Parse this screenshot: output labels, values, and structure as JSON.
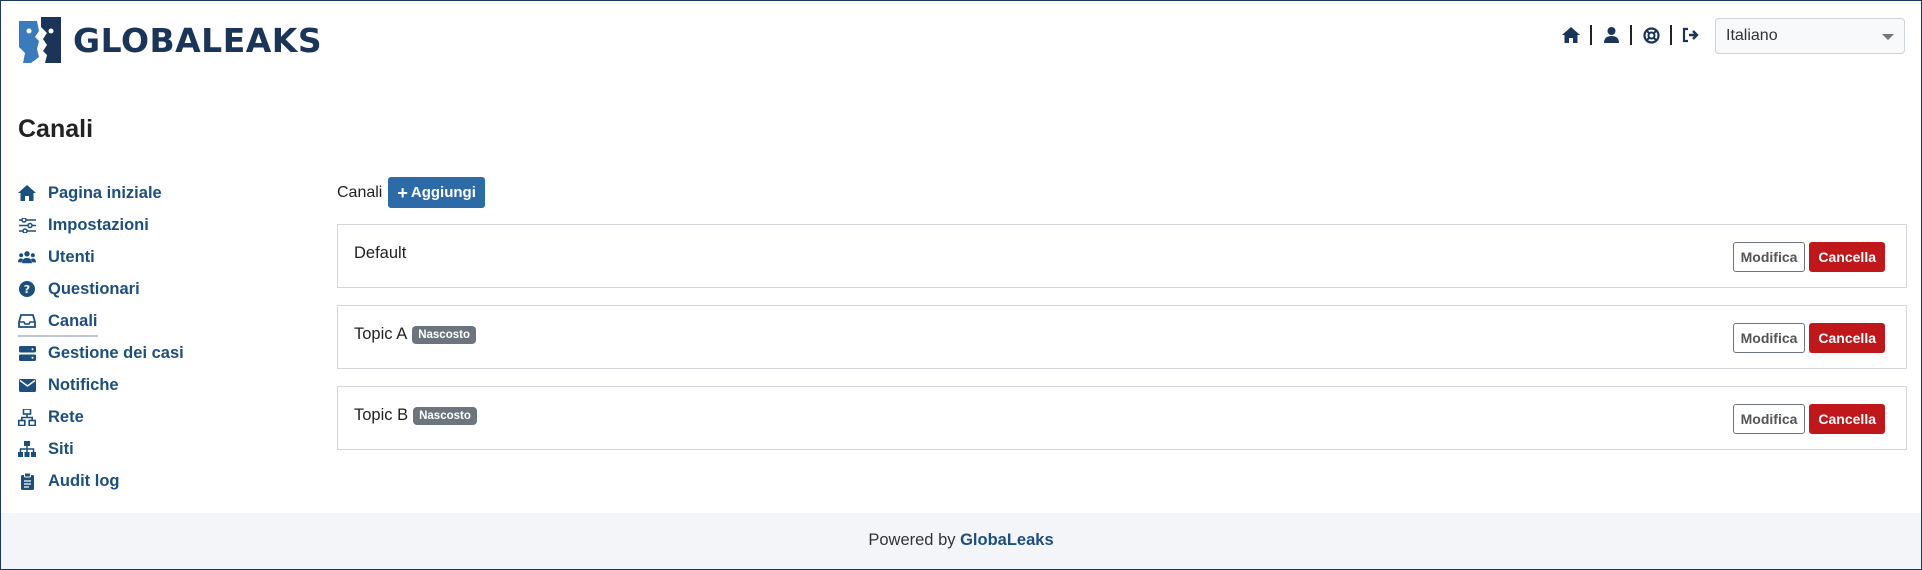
{
  "header": {
    "logo_text": "GLOBALEAKS",
    "language": "Italiano",
    "icons": [
      "home-icon",
      "user-icon",
      "support-icon",
      "logout-icon"
    ]
  },
  "page": {
    "title": "Canali"
  },
  "sidebar": {
    "items": [
      {
        "label": "Pagina iniziale",
        "icon": "home-icon"
      },
      {
        "label": "Impostazioni",
        "icon": "sliders-icon"
      },
      {
        "label": "Utenti",
        "icon": "users-icon"
      },
      {
        "label": "Questionari",
        "icon": "question-icon"
      },
      {
        "label": "Canali",
        "icon": "inbox-icon",
        "active": true
      },
      {
        "label": "Gestione dei casi",
        "icon": "server-icon"
      },
      {
        "label": "Notifiche",
        "icon": "envelope-icon"
      },
      {
        "label": "Rete",
        "icon": "network-icon"
      },
      {
        "label": "Siti",
        "icon": "sitemap-icon"
      },
      {
        "label": "Audit log",
        "icon": "clipboard-icon"
      }
    ]
  },
  "main": {
    "section_label": "Canali",
    "add_label": "Aggiungi",
    "edit_label": "Modifica",
    "delete_label": "Cancella",
    "channels": [
      {
        "name": "Default",
        "badge": ""
      },
      {
        "name": "Topic A",
        "badge": "Nascosto"
      },
      {
        "name": "Topic B",
        "badge": "Nascosto"
      }
    ]
  },
  "footer": {
    "prefix": "Powered by",
    "brand": "GlobaLeaks"
  },
  "colors": {
    "brand": "#1d4f7e",
    "primary": "#2c6aa8",
    "danger": "#c0171b",
    "badge": "#6c757d"
  }
}
